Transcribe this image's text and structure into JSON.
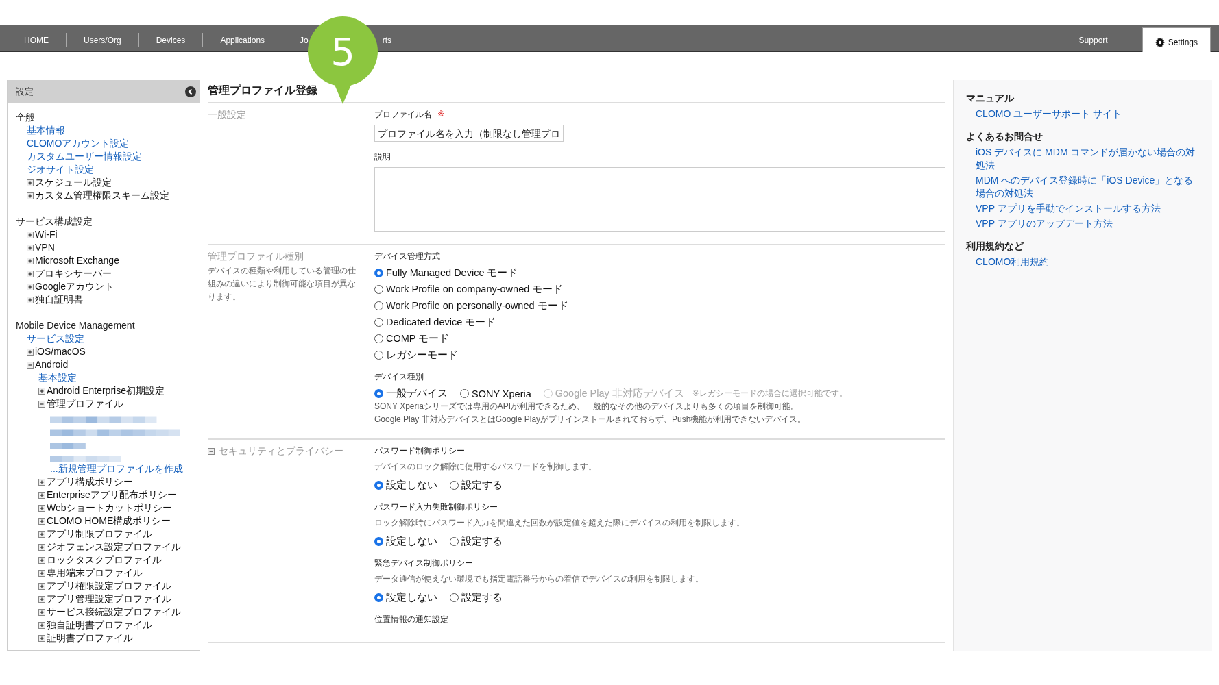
{
  "nav": {
    "left": [
      {
        "label": "HOME",
        "selected": false
      },
      {
        "label": "Users/Org",
        "selected": false
      },
      {
        "label": "Devices",
        "selected": false
      },
      {
        "label": "Applications",
        "selected": false
      },
      {
        "label": "Jo",
        "selected": false
      },
      {
        "label": "rts",
        "selected": false
      }
    ],
    "right": [
      {
        "label": "Support",
        "selected": false,
        "kind": "text"
      },
      {
        "label": "Settings",
        "selected": true,
        "kind": "gear"
      }
    ]
  },
  "callout": {
    "step": "5"
  },
  "sidebar": {
    "title": "設定",
    "sections": [
      {
        "title": "全般",
        "items": [
          {
            "label": "基本情報",
            "kind": "link"
          },
          {
            "label": "CLOMOアカウント設定",
            "kind": "link"
          },
          {
            "label": "カスタムユーザー情報設定",
            "kind": "link"
          },
          {
            "label": "ジオサイト設定",
            "kind": "link"
          },
          {
            "label": "スケジュール設定",
            "kind": "node",
            "expanded": false
          },
          {
            "label": "カスタム管理権限スキーム設定",
            "kind": "node",
            "expanded": false
          }
        ]
      },
      {
        "title": "サービス構成設定",
        "items": [
          {
            "label": "Wi-Fi",
            "kind": "node",
            "expanded": false
          },
          {
            "label": "VPN",
            "kind": "node",
            "expanded": false
          },
          {
            "label": "Microsoft Exchange",
            "kind": "node",
            "expanded": false
          },
          {
            "label": "プロキシサーバー",
            "kind": "node",
            "expanded": false
          },
          {
            "label": "Googleアカウント",
            "kind": "node",
            "expanded": false
          },
          {
            "label": "独自証明書",
            "kind": "node",
            "expanded": false
          }
        ]
      },
      {
        "title": "Mobile Device Management",
        "items": [
          {
            "label": "サービス設定",
            "kind": "link"
          },
          {
            "label": "iOS/macOS",
            "kind": "node",
            "expanded": false
          },
          {
            "label": "Android",
            "kind": "node",
            "expanded": true,
            "children": [
              {
                "label": "基本設定",
                "kind": "link"
              },
              {
                "label": "Android Enterprise初期設定",
                "kind": "node",
                "expanded": false
              },
              {
                "label": "管理プロファイル",
                "kind": "node",
                "expanded": true,
                "children": [
                  {
                    "kind": "picture"
                  },
                  {
                    "label": "...新規管理プロファイルを作成",
                    "kind": "link"
                  }
                ]
              },
              {
                "label": "アプリ構成ポリシー",
                "kind": "node",
                "expanded": false
              },
              {
                "label": "Enterpriseアプリ配布ポリシー",
                "kind": "node",
                "expanded": false
              },
              {
                "label": "Webショートカットポリシー",
                "kind": "node",
                "expanded": false
              },
              {
                "label": "CLOMO HOME構成ポリシー",
                "kind": "node",
                "expanded": false
              },
              {
                "label": "アプリ制限プロファイル",
                "kind": "node",
                "expanded": false
              },
              {
                "label": "ジオフェンス設定プロファイル",
                "kind": "node",
                "expanded": false
              },
              {
                "label": "ロックタスクプロファイル",
                "kind": "node",
                "expanded": false
              },
              {
                "label": "専用端末プロファイル",
                "kind": "node",
                "expanded": false
              },
              {
                "label": "アプリ権限設定プロファイル",
                "kind": "node",
                "expanded": false
              },
              {
                "label": "アプリ管理設定プロファイル",
                "kind": "node",
                "expanded": false
              },
              {
                "label": "サービス接続設定プロファイル",
                "kind": "node",
                "expanded": false
              },
              {
                "label": "独自証明書プロファイル",
                "kind": "node",
                "expanded": false
              },
              {
                "label": "証明書プロファイル",
                "kind": "node",
                "expanded": false
              }
            ]
          }
        ]
      }
    ]
  },
  "main": {
    "title": "管理プロファイル登録",
    "sections": [
      {
        "heading": "一般設定",
        "groups": [
          {
            "kind": "text",
            "label": "プロファイル名",
            "mark": "※",
            "placeholder": "プロファイル名を入力（制限なし管理プロ"
          },
          {
            "kind": "textarea",
            "label": "説明"
          }
        ]
      },
      {
        "heading": "管理プロファイル種別",
        "description": "デバイスの種類や利用している管理の仕組みの違いにより制御可能な項目が異なります。",
        "groups": [
          {
            "kind": "radiolist",
            "label": "デバイス管理方式",
            "options": [
              {
                "label": "Fully Managed Device モード",
                "selected": true,
                "disabled": false
              },
              {
                "label": "Work Profile on company-owned モード",
                "selected": false,
                "disabled": false
              },
              {
                "label": "Work Profile on personally-owned モード",
                "selected": false,
                "disabled": false
              },
              {
                "label": "Dedicated device モード",
                "selected": false,
                "disabled": false
              },
              {
                "label": "COMP モード",
                "selected": false,
                "disabled": false
              },
              {
                "label": "レガシーモード",
                "selected": false,
                "disabled": false
              }
            ]
          },
          {
            "kind": "radiorow",
            "label": "デバイス種別",
            "options": [
              {
                "label": "一般デバイス",
                "selected": true,
                "disabled": false
              },
              {
                "label": "SONY Xperia",
                "selected": false,
                "disabled": false
              },
              {
                "label": "Google Play 非対応デバイス",
                "selected": false,
                "disabled": true
              }
            ],
            "note": "※レガシーモードの場合に選択可能です。",
            "hints": [
              "SONY Xperiaシリーズでは専用のAPIが利用できるため、一般的なその他のデバイスよりも多くの項目を制御可能。",
              "Google Play 非対応デバイスとはGoogle Playがプリインストールされておらず、Push機能が利用できないデバイス。"
            ]
          }
        ]
      },
      {
        "heading": "セキュリティとプライバシー",
        "expanded": true,
        "groups": [
          {
            "kind": "radiorow",
            "label": "パスワード制御ポリシー",
            "description": "デバイスのロック解除に使用するパスワードを制御します。",
            "options": [
              {
                "label": "設定しない",
                "selected": true,
                "disabled": false
              },
              {
                "label": "設定する",
                "selected": false,
                "disabled": false
              }
            ]
          },
          {
            "kind": "radiorow",
            "label": "パスワード入力失敗制御ポリシー",
            "description": "ロック解除時にパスワード入力を間違えた回数が設定値を超えた際にデバイスの利用を制限します。",
            "options": [
              {
                "label": "設定しない",
                "selected": true,
                "disabled": false
              },
              {
                "label": "設定する",
                "selected": false,
                "disabled": false
              }
            ]
          },
          {
            "kind": "radiorow",
            "label": "緊急デバイス制御ポリシー",
            "description": "データ通信が使えない環境でも指定電話番号からの着信でデバイスの利用を制限します。",
            "options": [
              {
                "label": "設定しない",
                "selected": true,
                "disabled": false
              },
              {
                "label": "設定する",
                "selected": false,
                "disabled": false
              }
            ]
          },
          {
            "kind": "label",
            "label": "位置情報の通知設定"
          }
        ]
      }
    ]
  },
  "help": [
    {
      "heading": "マニュアル",
      "links": [
        "CLOMO ユーザーサポート サイト"
      ]
    },
    {
      "heading": "よくあるお問合せ",
      "links": [
        "iOS デバイスに MDM コマンドが届かない場合の対処法",
        "MDM へのデバイス登録時に「iOS Device」となる場合の対処法",
        "VPP アプリを手動でインストールする方法",
        "VPP アプリのアップデート方法"
      ]
    },
    {
      "heading": "利用規約など",
      "links": [
        "CLOMO利用規約"
      ]
    }
  ]
}
